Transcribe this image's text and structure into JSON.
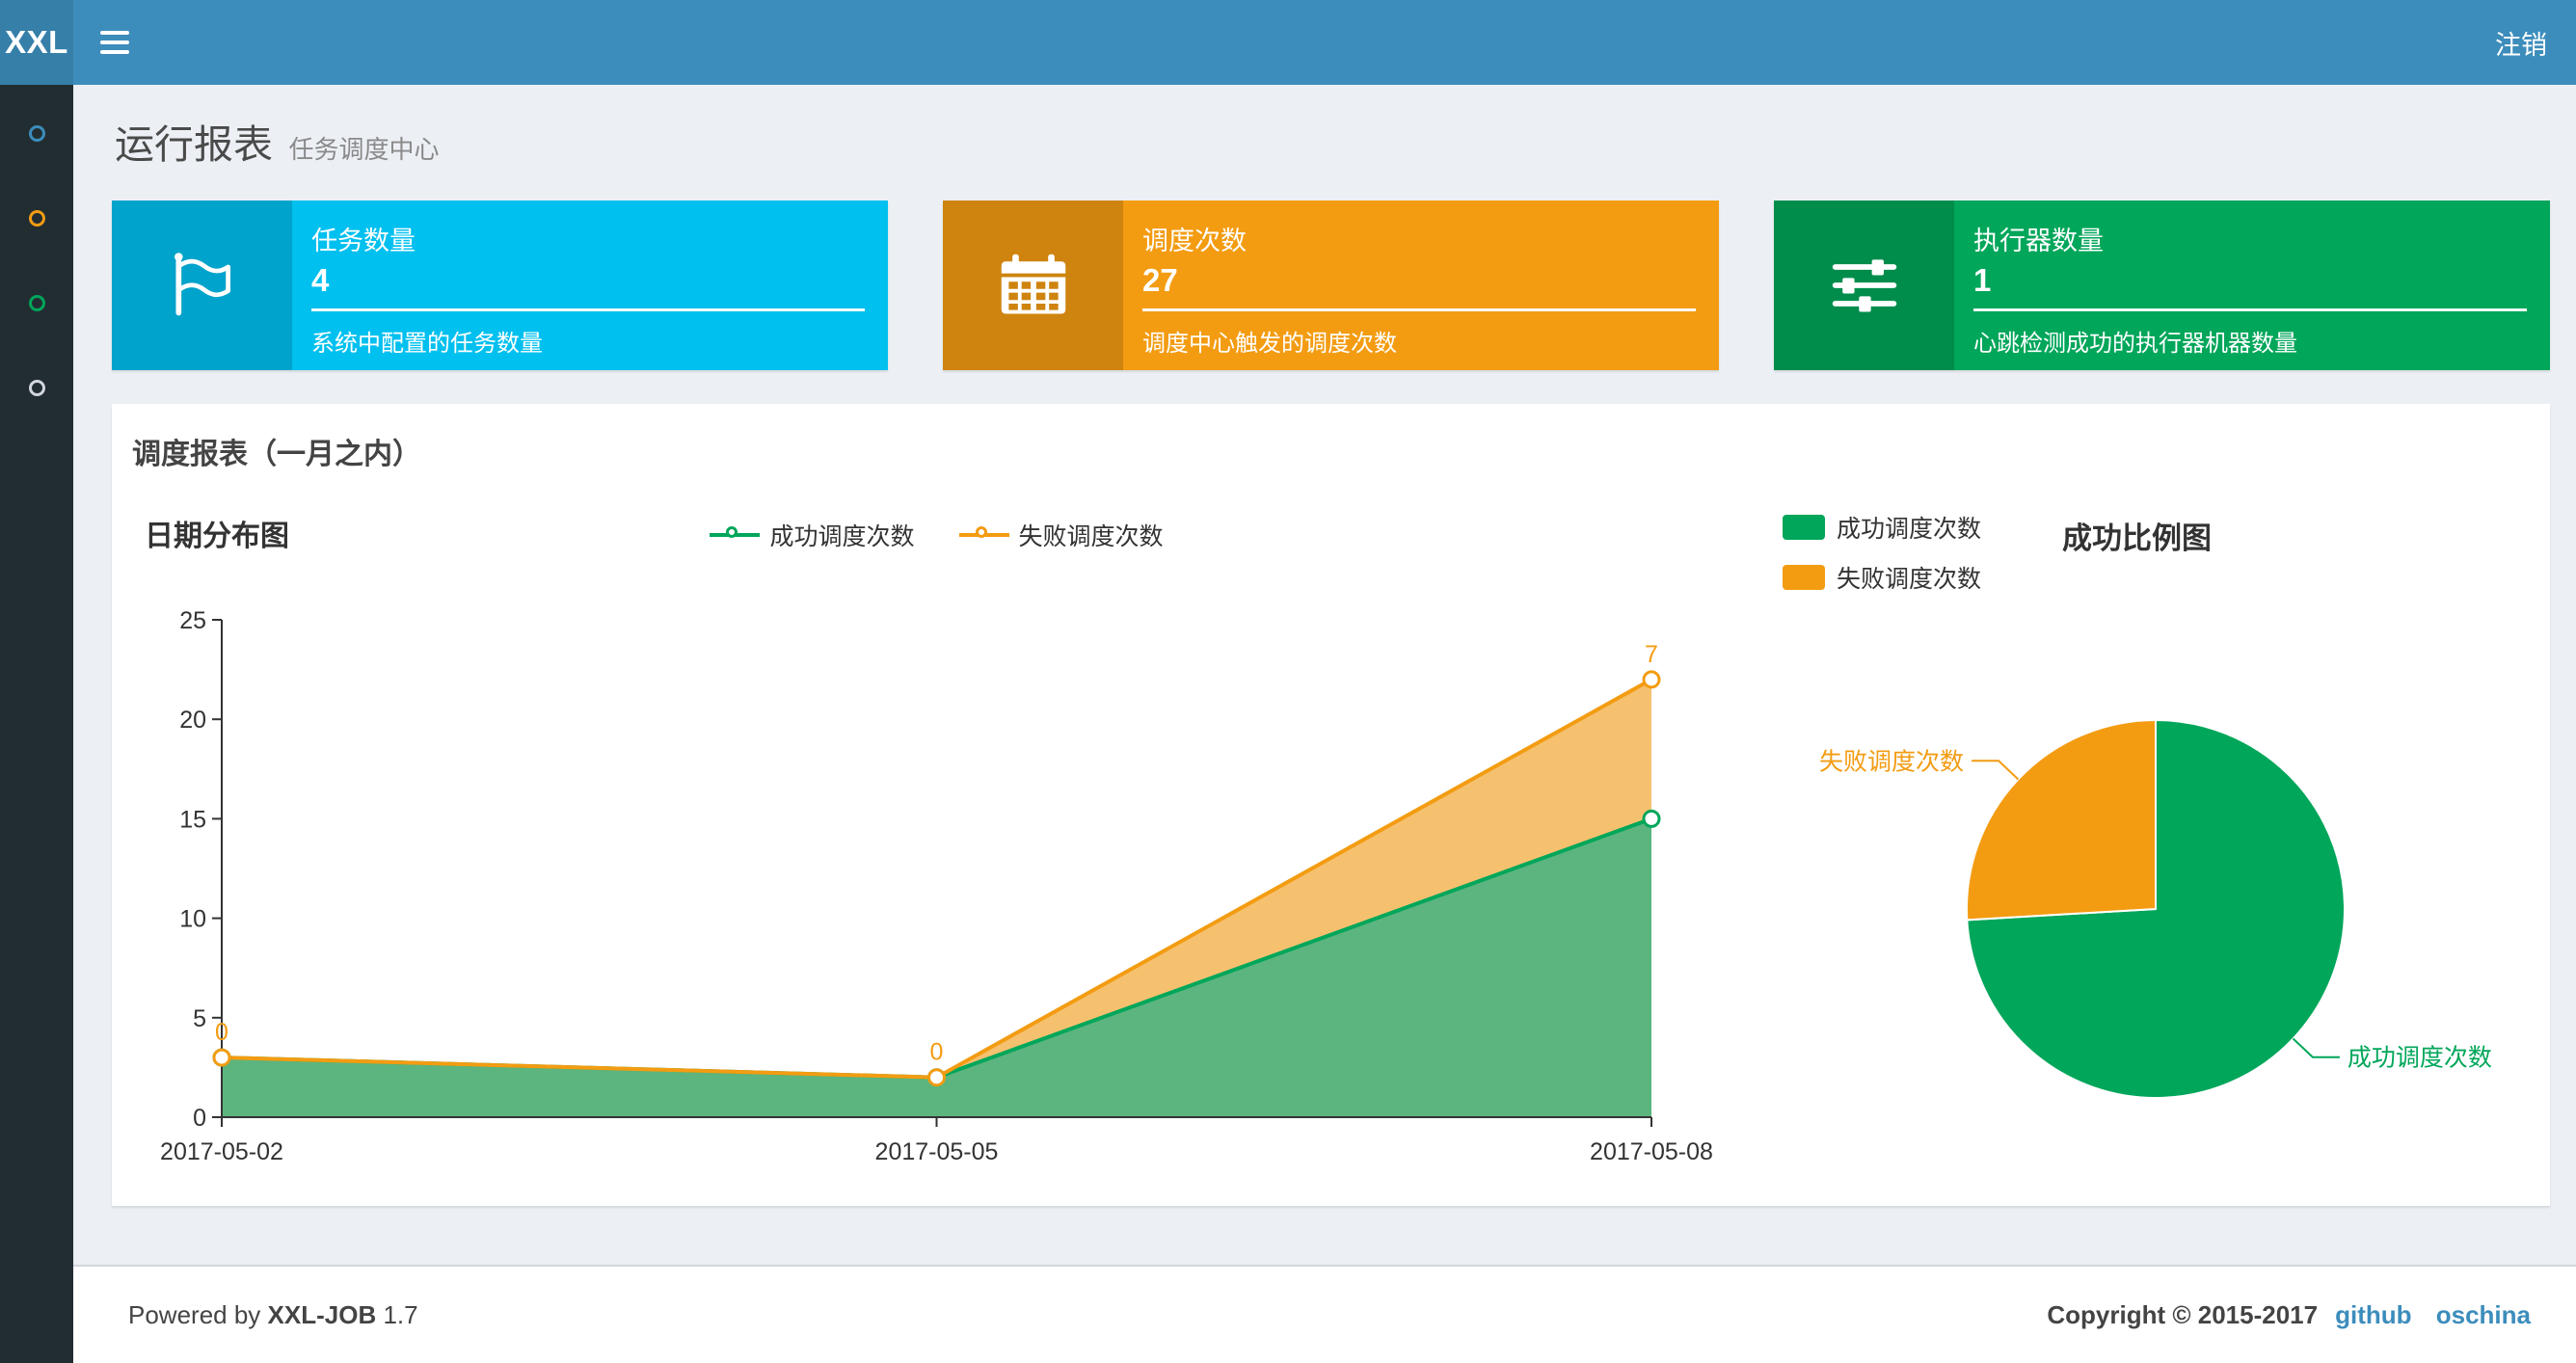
{
  "header": {
    "logo": "XXL",
    "logout_label": "注销"
  },
  "sidebar": {
    "items": [
      {
        "name": "menu-1",
        "color": "#3c8dbc"
      },
      {
        "name": "menu-2",
        "color": "#f39c12"
      },
      {
        "name": "menu-3",
        "color": "#00a65a"
      },
      {
        "name": "menu-4",
        "color": "#d2d6de"
      }
    ]
  },
  "page": {
    "title": "运行报表",
    "subtitle": "任务调度中心"
  },
  "info_boxes": [
    {
      "icon": "flag-icon",
      "color": "#00c0ef",
      "title": "任务数量",
      "value": "4",
      "desc": "系统中配置的任务数量"
    },
    {
      "icon": "calendar-icon",
      "color": "#f39c12",
      "title": "调度次数",
      "value": "27",
      "desc": "调度中心触发的调度次数"
    },
    {
      "icon": "sliders-icon",
      "color": "#00a65a",
      "title": "执行器数量",
      "value": "1",
      "desc": "心跳检测成功的执行器机器数量"
    }
  ],
  "panel": {
    "title": "调度报表（一月之内）"
  },
  "chart_data": [
    {
      "type": "area",
      "title": "日期分布图",
      "stacked": true,
      "categories": [
        "2017-05-02",
        "2017-05-05",
        "2017-05-08"
      ],
      "series": [
        {
          "name": "成功调度次数",
          "values": [
            3,
            2,
            15
          ],
          "color": "#00a65a",
          "fill": "#5cb57e"
        },
        {
          "name": "失败调度次数",
          "values": [
            0,
            0,
            7
          ],
          "color": "#f39c12",
          "fill": "#f6c16f",
          "labels": [
            "0",
            "0",
            "7"
          ]
        }
      ],
      "ylim": [
        0,
        25
      ],
      "yticks": [
        0,
        5,
        10,
        15,
        20,
        25
      ],
      "grid": false,
      "legend_position": "top-center"
    },
    {
      "type": "pie",
      "title": "成功比例图",
      "slices": [
        {
          "name": "成功调度次数",
          "value": 20,
          "color": "#00a65a"
        },
        {
          "name": "失败调度次数",
          "value": 7,
          "color": "#f39c12"
        }
      ],
      "legend_position": "top-left"
    }
  ],
  "footer": {
    "powered_prefix": "Powered by",
    "product": "XXL-JOB",
    "version": "1.7",
    "copyright": "Copyright © 2015-2017",
    "links": [
      "github",
      "oschina"
    ]
  }
}
